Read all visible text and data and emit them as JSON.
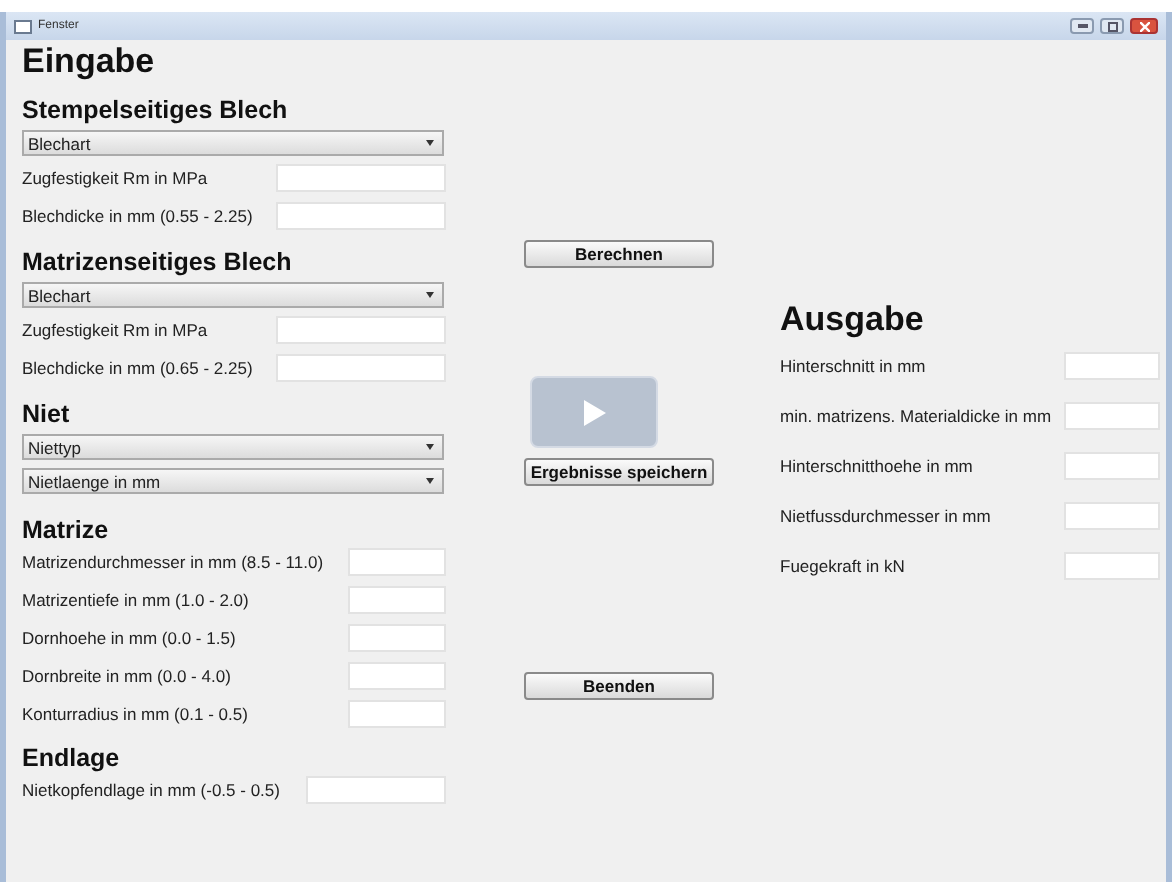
{
  "window": {
    "title": "Fenster"
  },
  "input": {
    "title": "Eingabe",
    "sections": [
      {
        "title": "Stempelseitiges Blech",
        "items": [
          {
            "kind": "dropdown",
            "label": "Blechart"
          },
          {
            "kind": "field",
            "label": "Zugfestigkeit Rm in MPa"
          },
          {
            "kind": "field",
            "label": "Blechdicke in mm (0.55 - 2.25)"
          }
        ]
      },
      {
        "title": "Matrizenseitiges Blech",
        "items": [
          {
            "kind": "dropdown",
            "label": "Blechart"
          },
          {
            "kind": "field",
            "label": "Zugfestigkeit Rm in MPa"
          },
          {
            "kind": "field",
            "label": "Blechdicke in mm (0.65 - 2.25)"
          }
        ]
      },
      {
        "title": "Niet",
        "items": [
          {
            "kind": "dropdown",
            "label": "Niettyp"
          },
          {
            "kind": "dropdown",
            "label": "Nietlaenge in mm"
          }
        ]
      },
      {
        "title": "Matrize",
        "items": [
          {
            "kind": "short_field",
            "label": "Matrizendurchmesser  in mm (8.5 - 11.0)"
          },
          {
            "kind": "short_field",
            "label": "Matrizentiefe  in mm (1.0 - 2.0)"
          },
          {
            "kind": "short_field",
            "label": "Dornhoehe  in mm (0.0 - 1.5)"
          },
          {
            "kind": "short_field",
            "label": "Dornbreite  in mm (0.0 - 4.0)"
          },
          {
            "kind": "short_field",
            "label": "Konturradius  in mm (0.1 - 0.5)"
          }
        ]
      },
      {
        "title": "Endlage",
        "items": [
          {
            "kind": "mid_field",
            "label": "Nietkopfendlage  in mm (-0.5 - 0.5)"
          }
        ]
      }
    ]
  },
  "actions": [
    {
      "kind": "button",
      "label": "Berechnen"
    },
    {
      "kind": "play"
    },
    {
      "kind": "button",
      "label": "Ergebnisse speichern"
    },
    {
      "kind": "button",
      "label": "Beenden"
    }
  ],
  "output": {
    "title": "Ausgabe",
    "items": [
      {
        "label": "Hinterschnitt in mm"
      },
      {
        "label": "min. matrizens. Materialdicke in mm"
      },
      {
        "label": "Hinterschnitthoehe in mm"
      },
      {
        "label": "Nietfussdurchmesser in mm"
      },
      {
        "label": "Fuegekraft in kN"
      }
    ]
  }
}
